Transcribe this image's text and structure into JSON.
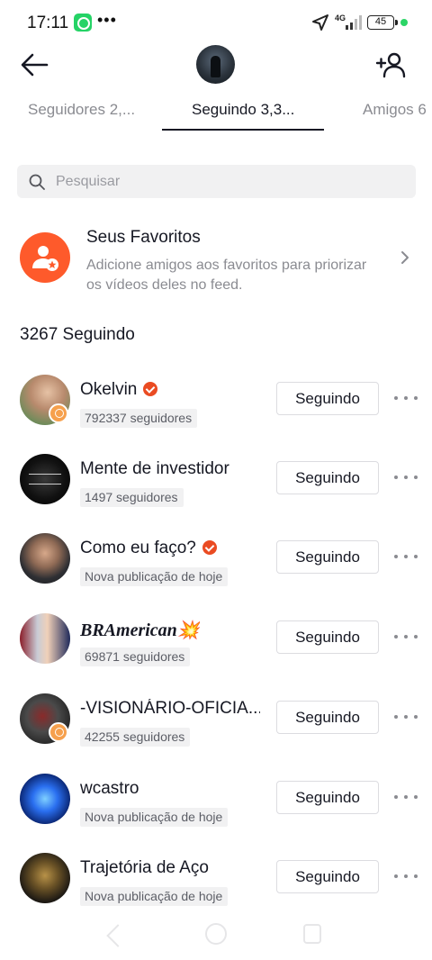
{
  "status_bar": {
    "time": "17:11",
    "more_dots": "•••",
    "network": "4G",
    "battery": "45"
  },
  "header": {
    "back_icon": "arrow-left-icon",
    "add_friend_icon": "add-user-icon"
  },
  "tabs": [
    {
      "label": "Seguidores 2,...",
      "active": false
    },
    {
      "label": "Seguindo 3,3...",
      "active": true
    },
    {
      "label": "Amigos 6",
      "active": false
    }
  ],
  "search": {
    "placeholder": "Pesquisar"
  },
  "favorites": {
    "title": "Seus Favoritos",
    "description": "Adicione amigos aos favoritos para priorizar os vídeos deles no feed."
  },
  "following_count_label": "3267 Seguindo",
  "users": [
    {
      "name": "Okelvin",
      "verified": true,
      "live": true,
      "sub": "792337 seguidores",
      "button": "Seguindo"
    },
    {
      "name": "Mente de investidor",
      "verified": false,
      "live": false,
      "sub": "1497 seguidores",
      "button": "Seguindo"
    },
    {
      "name": "Como eu faço?",
      "verified": true,
      "live": false,
      "sub": "Nova publicação de hoje",
      "button": "Seguindo"
    },
    {
      "name": "BRAmerican💥",
      "verified": false,
      "live": false,
      "sub": "69871 seguidores",
      "button": "Seguindo"
    },
    {
      "name": "-VISIONÁRIO-OFICIA...",
      "verified": false,
      "live": true,
      "sub": "42255 seguidores",
      "button": "Seguindo"
    },
    {
      "name": "wcastro",
      "verified": false,
      "live": false,
      "sub": "Nova publicação de hoje",
      "button": "Seguindo"
    },
    {
      "name": "Trajetória de Aço",
      "verified": false,
      "live": false,
      "sub": "Nova publicação de hoje",
      "button": "Seguindo"
    }
  ],
  "colors": {
    "accent": "#fe5a2b",
    "verified": "#ea4b22",
    "text_primary": "#161823",
    "text_secondary": "#8a8b91"
  }
}
